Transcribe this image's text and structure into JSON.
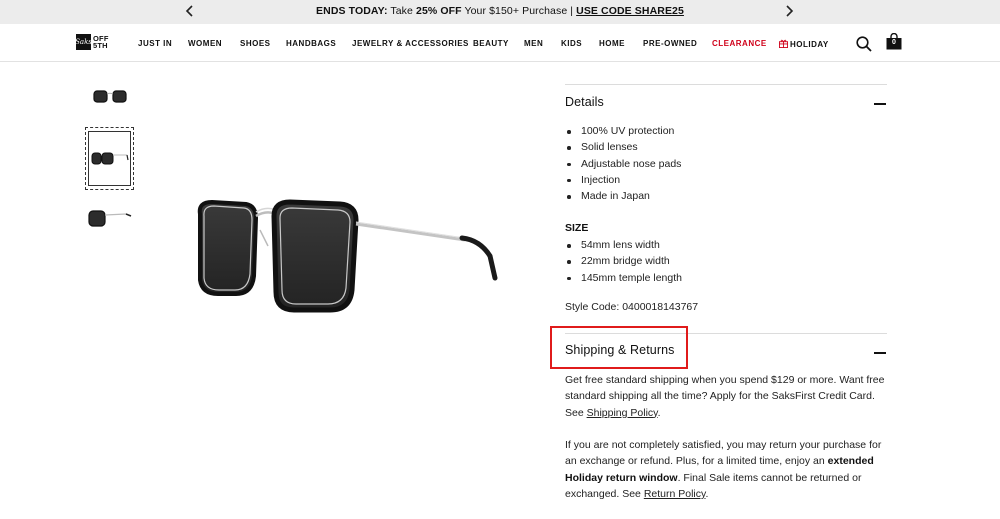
{
  "promo": {
    "lead": "ENDS TODAY:",
    "text_pre": " Take ",
    "bold": "25% OFF",
    "text_post": " Your $150+ Purchase | ",
    "code": "USE CODE SHARE25"
  },
  "header": {
    "logo_mark": "Saks",
    "logo_line1": "OFF",
    "logo_line2": "5TH",
    "nav": [
      "JUST IN",
      "WOMEN",
      "SHOES",
      "HANDBAGS",
      "JEWELRY & ACCESSORIES",
      "BEAUTY",
      "MEN",
      "KIDS",
      "HOME",
      "PRE-OWNED",
      "CLEARANCE",
      "HOLIDAY"
    ],
    "bag_count": "0",
    "clearance_color": "#d0021b"
  },
  "details": {
    "title": "Details",
    "features": [
      "100% UV protection",
      "Solid lenses",
      "Adjustable nose pads",
      "Injection",
      "Made in Japan"
    ],
    "size_heading": "SIZE",
    "sizes": [
      "54mm lens width",
      "22mm bridge width",
      "145mm temple length"
    ],
    "style_code": "Style Code: 0400018143767"
  },
  "shipping": {
    "title": "Shipping & Returns",
    "p1_text": "Get free standard shipping when you spend $129 or more. Want free standard shipping all the time? Apply for the SaksFirst Credit Card. See ",
    "p1_link": "Shipping Policy",
    "p1_end": ".",
    "p2_text": "If you are not completely satisfied, you may return your purchase for an exchange or refund. Plus, for a limited time, enjoy an ",
    "p2_bold": "extended Holiday return window",
    "p2_mid": ". Final Sale items cannot be returned or exchanged. See ",
    "p2_link": "Return Policy",
    "p2_end": "."
  },
  "colors": {
    "highlight": "#e01b1b",
    "accent_red": "#d0021b"
  }
}
